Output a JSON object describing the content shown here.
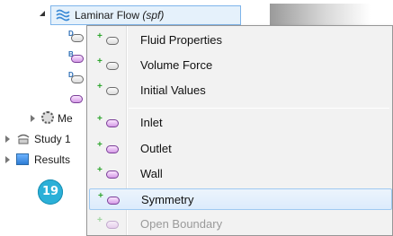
{
  "tree": {
    "root": {
      "label_main": "Laminar Flow",
      "label_tag": "(spf)"
    },
    "partial_items": [
      {
        "label": "Me",
        "icon": "mesh-gear-icon"
      },
      {
        "label": "Study 1",
        "icon": "study-icon"
      },
      {
        "label": "Results",
        "icon": "results-icon"
      }
    ]
  },
  "badge": {
    "text": "19",
    "color": "#2bb0d8"
  },
  "context_menu": {
    "groups": [
      {
        "items": [
          {
            "label": "Fluid Properties",
            "icon": "domain-node-icon",
            "enabled": true
          },
          {
            "label": "Volume Force",
            "icon": "domain-node-icon",
            "enabled": true
          },
          {
            "label": "Initial Values",
            "icon": "domain-node-icon",
            "enabled": true
          }
        ]
      },
      {
        "items": [
          {
            "label": "Inlet",
            "icon": "boundary-node-icon",
            "enabled": true
          },
          {
            "label": "Outlet",
            "icon": "boundary-node-icon",
            "enabled": true
          },
          {
            "label": "Wall",
            "icon": "boundary-node-icon",
            "enabled": true
          },
          {
            "label": "Symmetry",
            "icon": "boundary-node-icon",
            "enabled": true,
            "highlighted": true
          },
          {
            "label": "Open Boundary",
            "icon": "boundary-node-icon",
            "enabled": false
          }
        ]
      }
    ],
    "add_glyph": "+",
    "colors": {
      "add": "#2ea62e",
      "highlight": "#dcebfc",
      "highlight_border": "#9fc9f1",
      "boundary_icon": "#d59ae6"
    }
  }
}
